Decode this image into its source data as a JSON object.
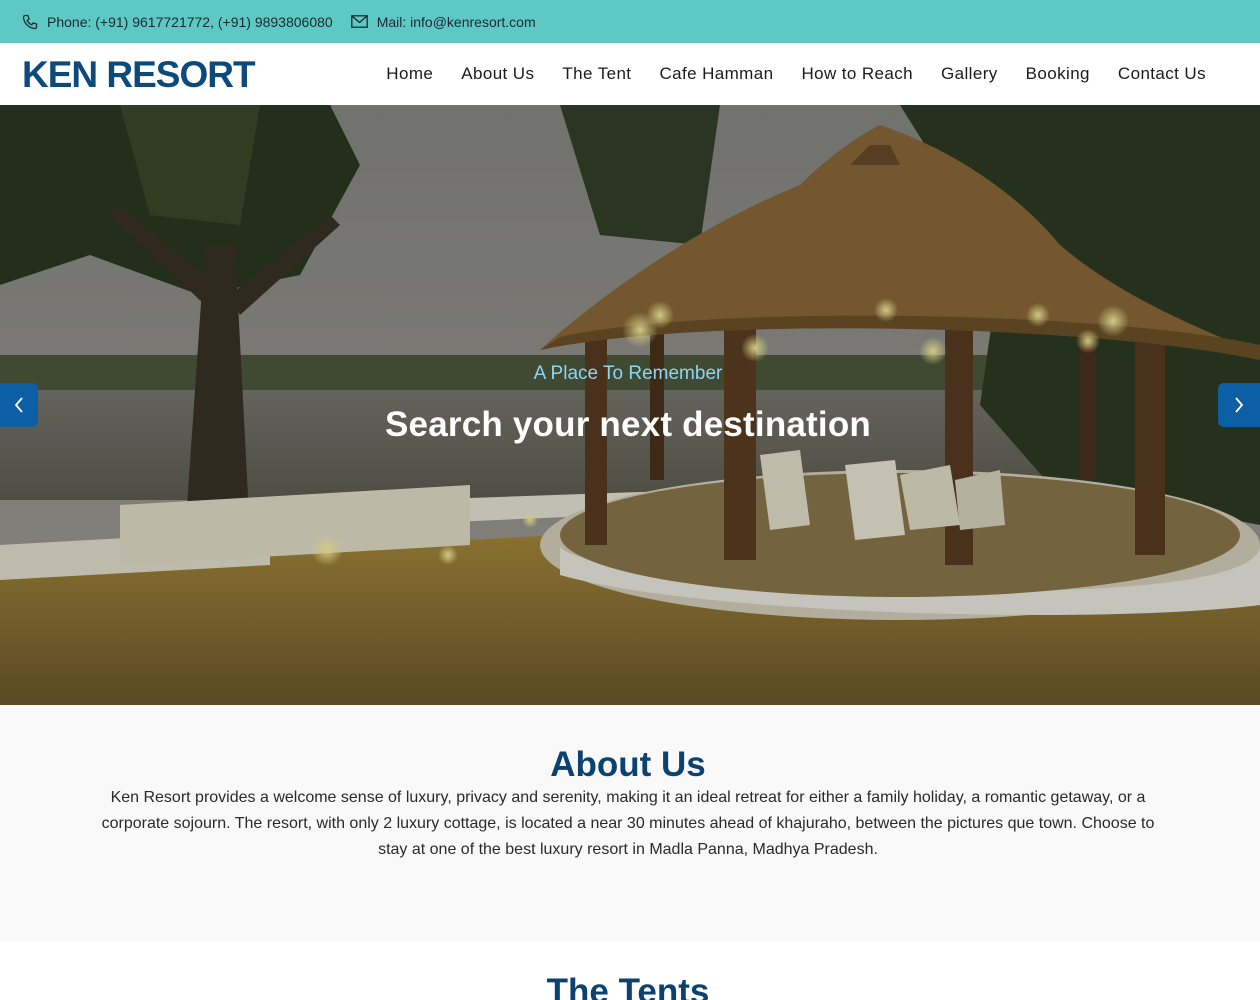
{
  "topbar": {
    "phone_icon": "phone-icon",
    "phone_text": "Phone: (+91) 9617721772, (+91) 9893806080",
    "mail_icon": "envelope-icon",
    "mail_text": "Mail: info@kenresort.com"
  },
  "header": {
    "logo": "KEN RESORT",
    "nav": [
      "Home",
      "About Us",
      "The Tent",
      "Cafe Hamman",
      "How to Reach",
      "Gallery",
      "Booking",
      "Contact Us"
    ]
  },
  "hero": {
    "subtitle": "A Place To Remember",
    "title": "Search your next destination",
    "prev_icon": "chevron-left-icon",
    "next_icon": "chevron-right-icon"
  },
  "about": {
    "heading": "About Us",
    "text": "Ken Resort provides a welcome sense of luxury, privacy and serenity, making it an ideal retreat for either a family holiday, a romantic getaway, or a corporate sojourn. The resort, with only 2 luxury cottage, is located a near 30 minutes ahead of khajuraho, between the pictures que town. Choose to stay at one of the best luxury resort in Madla Panna, Madhya Pradesh."
  },
  "tents": {
    "heading": "The Tents"
  },
  "colors": {
    "topbar_bg": "#5ec9c4",
    "brand_blue": "#0d4a7c",
    "arrow_bg": "#0d5fa5",
    "hero_subtitle": "#8fd5f0"
  }
}
